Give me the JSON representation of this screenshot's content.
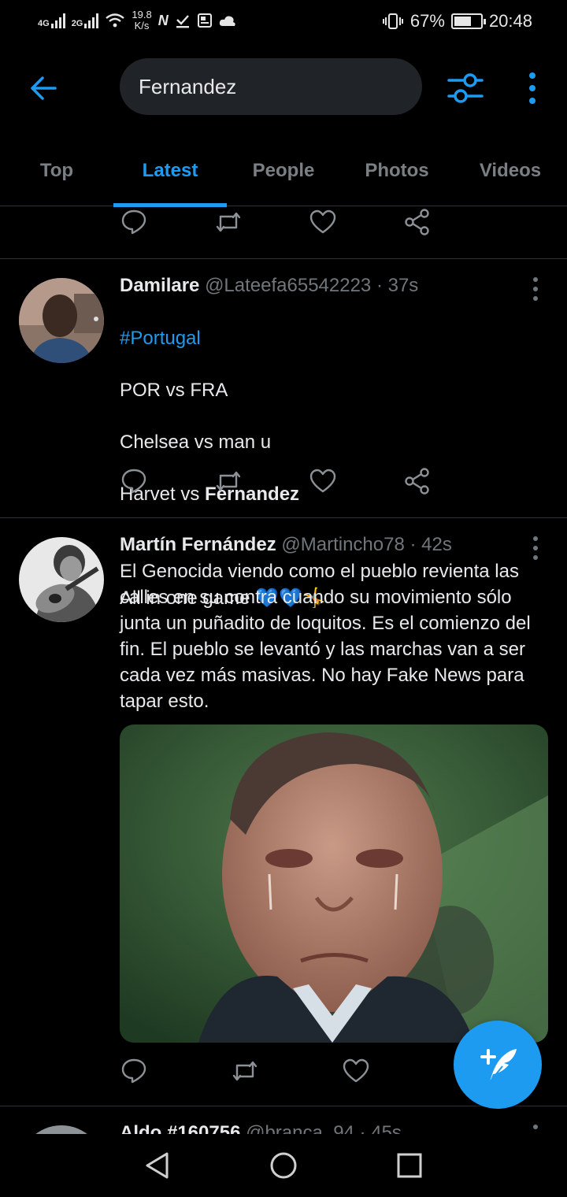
{
  "status_bar": {
    "signal_1": "4G",
    "signal_2": "2G",
    "net_speed_value": "19.8",
    "net_speed_unit": "K/s",
    "battery": "67%",
    "battery_level": 0.67,
    "time": "20:48"
  },
  "search": {
    "query": "Fernandez"
  },
  "tabs": [
    {
      "label": "Top",
      "active": false
    },
    {
      "label": "Latest",
      "active": true
    },
    {
      "label": "People",
      "active": false
    },
    {
      "label": "Photos",
      "active": false
    },
    {
      "label": "Videos",
      "active": false
    }
  ],
  "tweets": [
    {
      "name": "Damilare",
      "handle": "@Lateefa65542223",
      "time": "37s",
      "hashtag": "#Portugal",
      "line_1": "POR vs FRA",
      "line_2": "Chelsea vs man u",
      "line_3_prefix": "Harvet vs ",
      "line_3_bold": "Fernandez",
      "line_5": "All in one game 💙💙🤸"
    },
    {
      "name": "Martín Fernández",
      "handle": "@Martincho78",
      "time": "42s",
      "text": "El Genocida viendo como el pueblo revienta las calles en su contra cuando su movimiento sólo junta un puñadito de loquitos. Es el comienzo del fin. El pueblo se levantó y las marchas van a ser cada vez más masivas. No hay Fake News para tapar esto."
    },
    {
      "name": "Aldo #160756",
      "handle": "@branca_94",
      "time": "45s"
    }
  ],
  "separator": " · ",
  "icons": {
    "back": "arrow-left-icon",
    "filter": "sliders-icon",
    "more": "more-vertical-icon",
    "reply": "reply-icon",
    "retweet": "retweet-icon",
    "like": "heart-icon",
    "share": "share-icon",
    "compose": "compose-tweet-icon"
  },
  "colors": {
    "accent": "#1d9bf0",
    "background": "#000000",
    "divider": "#2f3336"
  }
}
